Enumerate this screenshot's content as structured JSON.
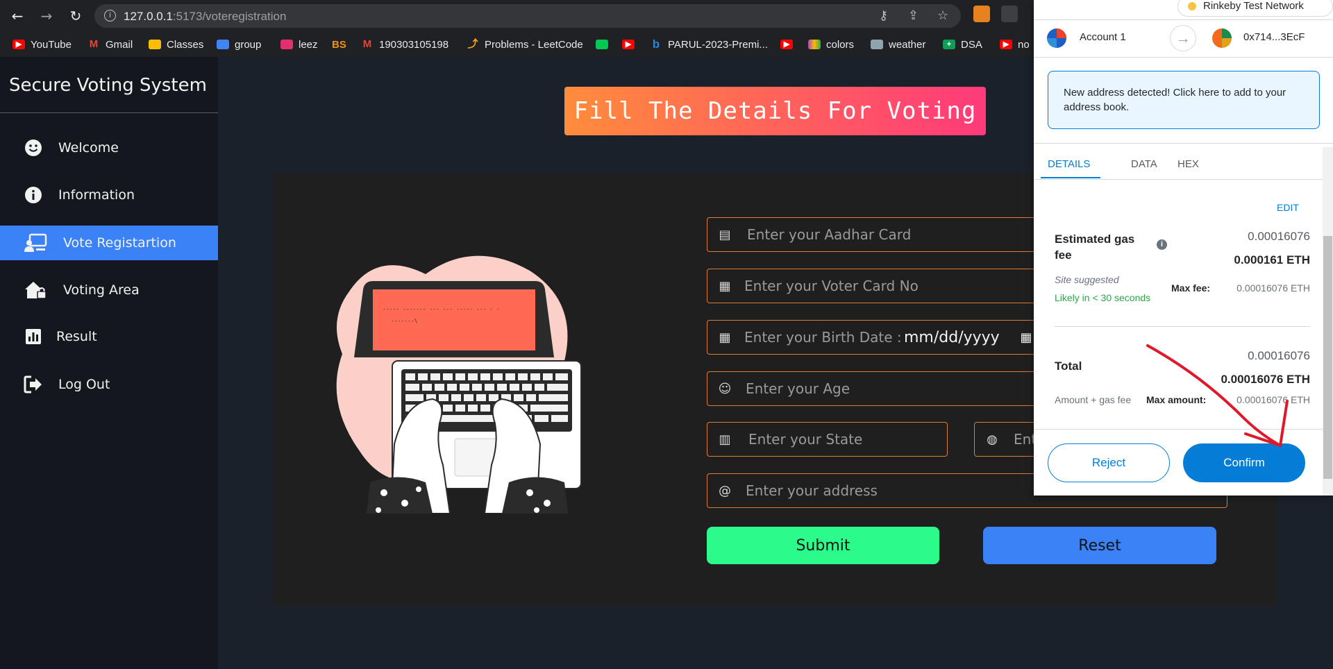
{
  "browser": {
    "url_host": "127.0.0.1",
    "url_rest": ":5173/voteregistration",
    "bookmarks": [
      {
        "label": "YouTube",
        "color": "#ff0000"
      },
      {
        "label": "Gmail",
        "color": "#ea4335"
      },
      {
        "label": "Classes",
        "color": "#fbbc04"
      },
      {
        "label": "group",
        "color": "#4285f4"
      },
      {
        "label": "leez",
        "color": "#e1306c"
      },
      {
        "label": "BS",
        "color": "#f29111"
      },
      {
        "label": "190303105198",
        "color": "#ea4335"
      },
      {
        "label": "Problems - LeetCode",
        "color": "#ffa116"
      },
      {
        "label": "",
        "color": "#00c853"
      },
      {
        "label": "",
        "color": "#ff0000"
      },
      {
        "label": "PARUL-2023-Premi...",
        "color": "#1e88e5"
      },
      {
        "label": "",
        "color": "#ff0000"
      },
      {
        "label": "colors",
        "color": "#ab47bc"
      },
      {
        "label": "weather",
        "color": "#90a4ae"
      },
      {
        "label": "DSA",
        "color": "#0f9d58"
      },
      {
        "label": "no",
        "color": "#ff0000"
      }
    ]
  },
  "sidebar": {
    "title": "Secure Voting System",
    "items": [
      {
        "label": "Welcome",
        "icon": "smiley-icon"
      },
      {
        "label": "Information",
        "icon": "info-icon"
      },
      {
        "label": "Vote Registartion",
        "icon": "registration-icon",
        "active": true
      },
      {
        "label": "Voting Area",
        "icon": "house-lock-icon"
      },
      {
        "label": "Result",
        "icon": "bar-chart-icon"
      },
      {
        "label": "Log Out",
        "icon": "logout-icon"
      }
    ]
  },
  "main": {
    "banner": "Fill The Details For Voting",
    "illustration_text_1": "----- ------- --- ---    ----- --- - -",
    "illustration_text_2": "-------\\",
    "form": {
      "aadhar_placeholder": "Enter your Aadhar Card",
      "voter_placeholder": "Enter your Voter Card No",
      "birth_label": "Enter your Birth Date :",
      "birth_value": "mm/dd/yyyy",
      "age_placeholder": "Enter your Age",
      "state_placeholder": "Enter your State",
      "city_placeholder": "Ent",
      "address_placeholder": "Enter your address"
    },
    "submit_label": "Submit",
    "reset_label": "Reset",
    "colors": {
      "submit": "#2bfb8a",
      "reset": "#3b82f6",
      "accent": "#e07b39"
    }
  },
  "metamask": {
    "network": "Rinkeby Test Network",
    "account_from": "Account 1",
    "account_to": "0x714...3EcF",
    "notice": "New address detected! Click here to add to your address book.",
    "tabs": [
      "DETAILS",
      "DATA",
      "HEX"
    ],
    "edit_label": "EDIT",
    "gas_label": "Estimated gas fee",
    "gas_value_small": "0.00016076",
    "gas_value_bold": "0.000161 ETH",
    "site_suggested": "Site suggested",
    "likely": "Likely in < 30 seconds",
    "max_fee_label": "Max fee:",
    "max_fee_value": "0.00016076 ETH",
    "total_label": "Total",
    "total_value_small": "0.00016076",
    "total_value_bold": "0.00016076 ETH",
    "amount_gas": "Amount + gas fee",
    "max_amount_label": "Max amount:",
    "max_amount_value": "0.00016076 ETH",
    "reject_label": "Reject",
    "confirm_label": "Confirm",
    "colors": {
      "primary": "#037dd6",
      "success": "#28a745",
      "annotation": "#e0182a"
    }
  }
}
